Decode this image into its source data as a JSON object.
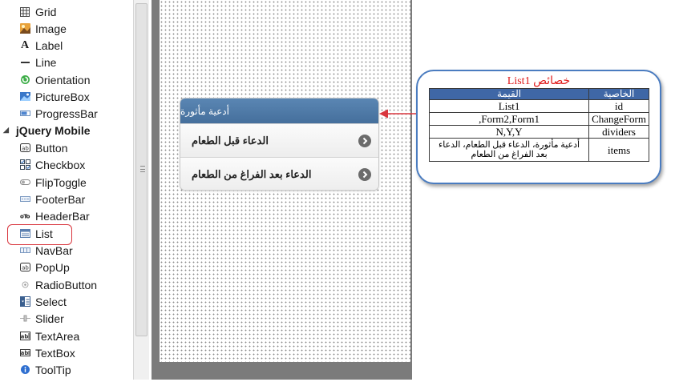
{
  "toolbox": {
    "items_top": [
      {
        "label": "Grid",
        "icon": "grid-icon"
      },
      {
        "label": "Image",
        "icon": "image-icon"
      },
      {
        "label": "Label",
        "icon": "label-icon"
      },
      {
        "label": "Line",
        "icon": "line-icon"
      },
      {
        "label": "Orientation",
        "icon": "orientation-icon"
      },
      {
        "label": "PictureBox",
        "icon": "picturebox-icon"
      },
      {
        "label": "ProgressBar",
        "icon": "progressbar-icon"
      }
    ],
    "category": {
      "label": "jQuery Mobile",
      "expanded": true
    },
    "items_mobile": [
      {
        "label": "Button",
        "icon": "button-icon"
      },
      {
        "label": "Checkbox",
        "icon": "checkbox-icon"
      },
      {
        "label": "FlipToggle",
        "icon": "fliptoggle-icon"
      },
      {
        "label": "FooterBar",
        "icon": "footerbar-icon"
      },
      {
        "label": "HeaderBar",
        "icon": "headerbar-icon"
      },
      {
        "label": "List",
        "icon": "list-icon",
        "highlighted": true
      },
      {
        "label": "NavBar",
        "icon": "navbar-icon"
      },
      {
        "label": "PopUp",
        "icon": "popup-icon"
      },
      {
        "label": "RadioButton",
        "icon": "radiobutton-icon"
      },
      {
        "label": "Select",
        "icon": "select-icon"
      },
      {
        "label": "Slider",
        "icon": "slider-icon"
      },
      {
        "label": "TextArea",
        "icon": "textarea-icon"
      },
      {
        "label": "TextBox",
        "icon": "textbox-icon"
      },
      {
        "label": "ToolTip",
        "icon": "tooltip-icon"
      }
    ]
  },
  "mobile_list": {
    "divider": "أدعية مأثورة",
    "items": [
      "الدعاء قبل الطعام",
      "الدعاء بعد الفراغ من الطعام"
    ],
    "divider_color": "#4e7aa8"
  },
  "properties": {
    "title": "خصائص List1",
    "header_value": "القيمة",
    "header_property": "الخاصية",
    "rows": [
      {
        "value": "List1",
        "property": "id"
      },
      {
        "value": ",Form2,Form1",
        "property": "ChangeForm"
      },
      {
        "value": "N,Y,Y",
        "property": "dividers"
      },
      {
        "value": "أدعية مأثورة، الدعاء قبل الطعام، الدعاء بعد الفراغ من الطعام",
        "property": "items"
      }
    ],
    "accent_color": "#3f67a6",
    "title_color": "#e01a1a"
  },
  "colors": {
    "highlight": "#d9363e",
    "arrow": "#d9363e"
  }
}
